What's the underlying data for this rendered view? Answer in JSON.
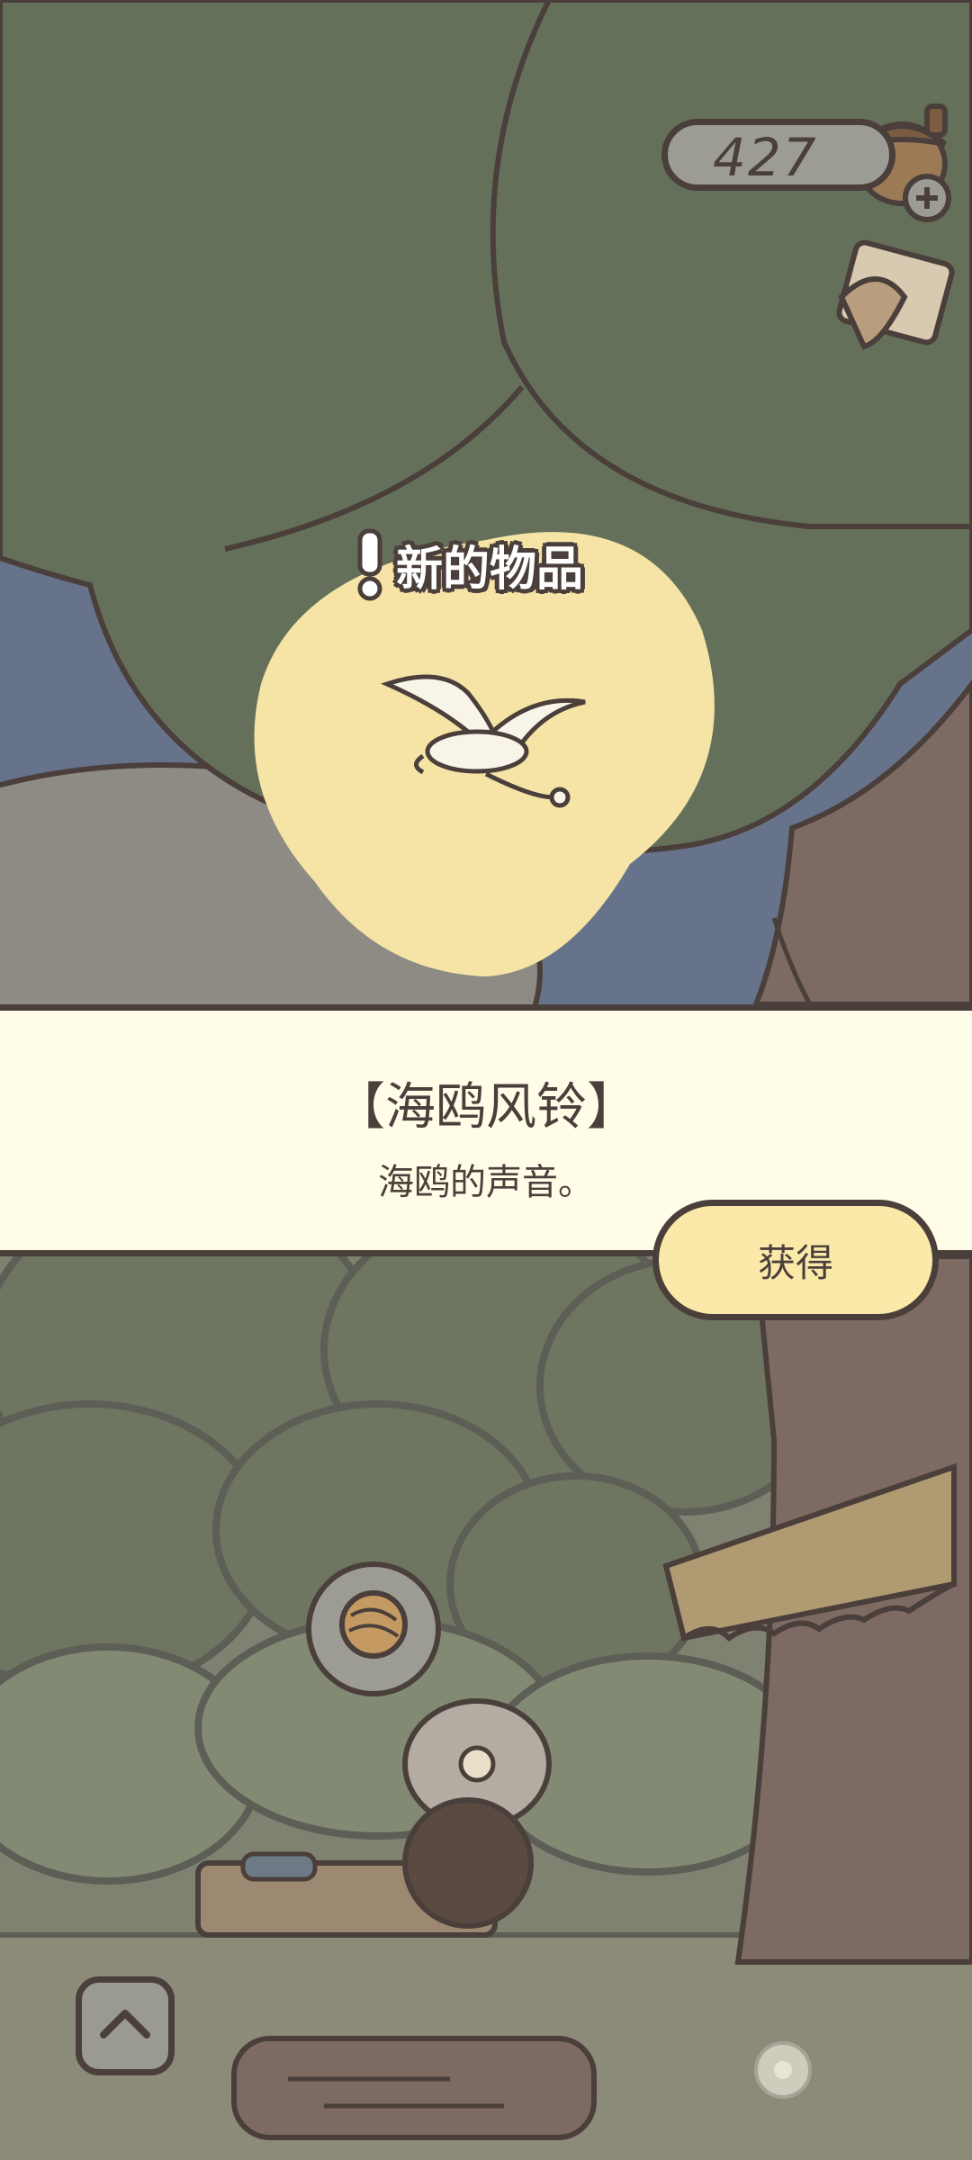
{
  "currency": {
    "value": "427",
    "icon": "acorn-icon",
    "add_icon": "plus-icon"
  },
  "mail": {
    "icon": "letter-icon"
  },
  "popup": {
    "label": "新的物品",
    "alert_icon": "exclamation-icon",
    "item_icon": "seagull-wind-chime-icon"
  },
  "item": {
    "name": "【海鸥风铃】",
    "description": "海鸥的声音。"
  },
  "buttons": {
    "obtain": "获得",
    "expand_icon": "chevron-up-icon"
  },
  "shop": {
    "thought_icon": "yarn-ball-icon"
  },
  "colors": {
    "outline": "#4a3f3a",
    "panel": "#fffce8",
    "button": "#fbe9aa",
    "tree": "#65705b",
    "glow": "#f6e4a6"
  }
}
